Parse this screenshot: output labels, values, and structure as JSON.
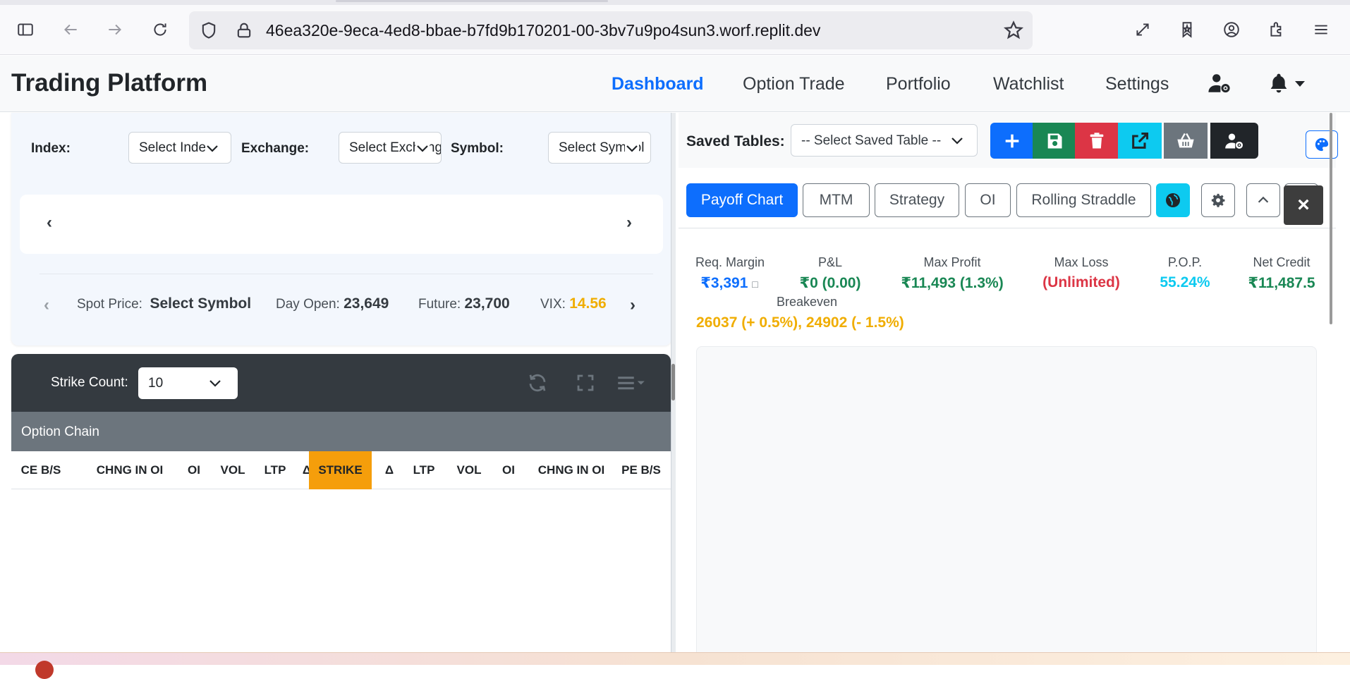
{
  "browser": {
    "url": "46ea320e-9eca-4ed8-bbae-b7fd9b170201-00-3bv7u9po4sun3.worf.replit.dev"
  },
  "navbar": {
    "brand": "Trading Platform",
    "links": [
      {
        "label": "Dashboard",
        "active": true
      },
      {
        "label": "Option Trade"
      },
      {
        "label": "Portfolio"
      },
      {
        "label": "Watchlist"
      },
      {
        "label": "Settings"
      }
    ]
  },
  "filters": {
    "index_label": "Index:",
    "index_value": "Select Index",
    "exchange_label": "Exchange:",
    "exchange_value": "Select Exchange",
    "symbol_label": "Symbol:",
    "symbol_value": "Select Symbol"
  },
  "carousel": {
    "prev": "‹",
    "next": "›"
  },
  "market_info": {
    "spot_label": "Spot Price:",
    "spot_value": "Select Symbol",
    "day_open_label": "Day Open:",
    "day_open_value": "23,649",
    "future_label": "Future:",
    "future_value": "23,700",
    "vix_label": "VIX:",
    "vix_value": "14.56",
    "vix_color": "#f0ad00"
  },
  "chain_toolbar": {
    "strike_count_label": "Strike Count:",
    "strike_count_value": "10"
  },
  "option_chain": {
    "title": "Option Chain",
    "columns": [
      "CE B/S",
      "CHNG IN OI",
      "OI",
      "VOL",
      "LTP",
      "Δ",
      "STRIKE",
      "Δ",
      "LTP",
      "VOL",
      "OI",
      "CHNG IN OI",
      "PE B/S"
    ]
  },
  "saved_tables": {
    "label": "Saved Tables:",
    "select_value": "-- Select Saved Table --"
  },
  "action_buttons": [
    {
      "name": "add",
      "icon": "plus-icon",
      "color": "#0d6efd"
    },
    {
      "name": "save",
      "icon": "floppy-icon",
      "color": "#198754"
    },
    {
      "name": "delete",
      "icon": "trash-icon",
      "color": "#dc3545"
    },
    {
      "name": "export",
      "icon": "external-link-icon",
      "color": "#0dcaf0"
    },
    {
      "name": "basket",
      "icon": "basket-icon",
      "color": "#6c757d"
    },
    {
      "name": "user-settings",
      "icon": "user-cog-icon",
      "color": "#212529"
    }
  ],
  "analysis_tabs": [
    "Payoff Chart",
    "MTM",
    "Strategy",
    "OI",
    "Rolling Straddle"
  ],
  "metrics": {
    "req_margin_label": "Req. Margin",
    "req_margin_value": "₹3,391",
    "pnl_label": "P&L",
    "pnl_value": "₹0 (0.00)",
    "max_profit_label": "Max Profit",
    "max_profit_value": "₹11,493 (1.3%)",
    "max_loss_label": "Max Loss",
    "max_loss_value": "(Unlimited)",
    "pop_label": "P.O.P.",
    "pop_value": "55.24%",
    "net_credit_label": "Net Credit",
    "net_credit_value": "₹11,487.5",
    "breakeven_label": "Breakeven",
    "breakeven_value": "26037 (+ 0.5%), 24902 (- 1.5%)"
  }
}
